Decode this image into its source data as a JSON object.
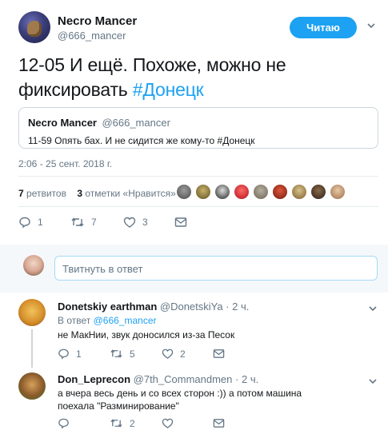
{
  "tweet": {
    "author_name": "Necro Mancer",
    "author_handle": "@666_mancer",
    "follow_label": "Читаю",
    "text_main": "12-05 И ещё. Похоже, можно не фиксировать ",
    "hashtag": "#Донецк",
    "quote": {
      "name": "Necro Mancer",
      "handle": "@666_mancer",
      "text": "11-59 Опять бах. И не сидится же кому-то #Донецк"
    },
    "timestamp": "2:06 - 25 сент. 2018 г.",
    "retweets_count": "7",
    "retweets_label": "ретвитов",
    "likes_count": "3",
    "likes_label": "отметки «Нравится»",
    "actions": {
      "reply_count": "1",
      "retweet_count": "7",
      "like_count": "3"
    }
  },
  "reply_box": {
    "placeholder": "Твитнуть в ответ"
  },
  "replies": [
    {
      "name": "Donetskiy earthman",
      "handle": "@DonetskiYa",
      "time": "· 2 ч.",
      "in_reply_prefix": "В ответ ",
      "in_reply_handle": "@666_mancer",
      "text": "не МакНии, звук доносился из-за Песок",
      "reply_count": "1",
      "retweet_count": "5",
      "like_count": "2"
    },
    {
      "name": "Don_Leprecon",
      "handle": "@7th_Commandmen",
      "time": "· 2 ч.",
      "text": "а вчера весь день и со всех сторон :)) а потом машина поехала \"Разминирование\"",
      "reply_count": "",
      "retweet_count": "2",
      "like_count": ""
    }
  ],
  "colors": {
    "accent": "#1da1f2",
    "secondary_text": "#657786",
    "border": "#e6ecf0"
  },
  "icons": [
    "chevron-down-icon",
    "reply-icon",
    "retweet-icon",
    "heart-icon",
    "message-icon"
  ]
}
